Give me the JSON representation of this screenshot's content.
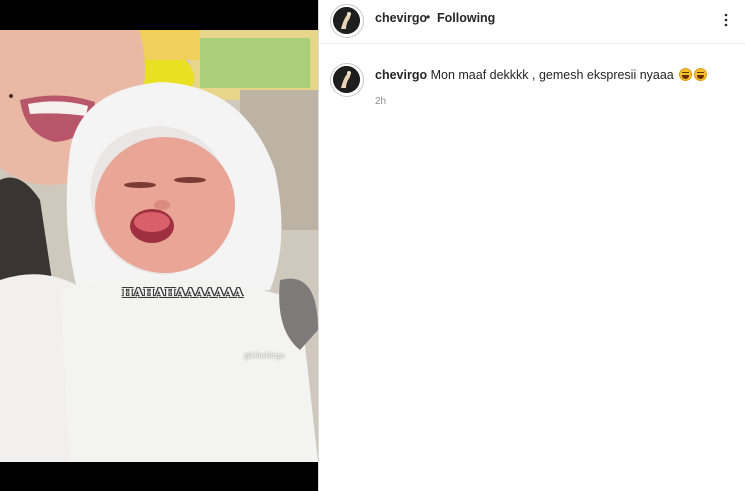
{
  "post": {
    "username": "chevirgo",
    "separator": "•",
    "follow_status": "Following",
    "more_icon": "more-options-icon"
  },
  "media": {
    "overlay_text": "HAHAHAAAAAAA",
    "watermark": "@CheVirgo"
  },
  "comment": {
    "username": "chevirgo",
    "text": "Mon maaf dekkkk , gemesh ekspresii nyaaa",
    "emojis": [
      "grinning-sweat-emoji",
      "grinning-sweat-emoji"
    ],
    "time": "2h"
  },
  "colors": {
    "text": "#262626",
    "muted": "#8e8e8e",
    "border": "#dbdbdb"
  }
}
